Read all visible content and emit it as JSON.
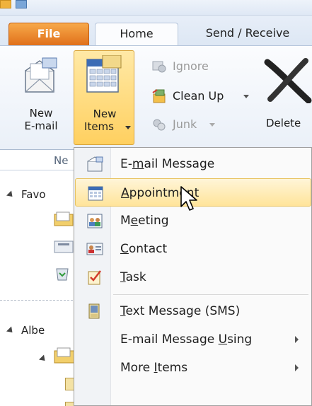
{
  "ribbon": {
    "tabs": [
      {
        "id": "file",
        "label": "File"
      },
      {
        "id": "home",
        "label": "Home"
      },
      {
        "id": "send",
        "label": "Send / Receive"
      }
    ],
    "new_email_line1": "New",
    "new_email_line2": "E-mail",
    "new_items_line1": "New",
    "new_items_line2": "Items",
    "ignore": "Ignore",
    "cleanup": "Clean Up",
    "junk": "Junk",
    "delete": "Delete",
    "group_label_partial": "Ne"
  },
  "nav": {
    "favorites_partial": "Favo",
    "account_partial": "Albe"
  },
  "menu": {
    "items": [
      {
        "pre": "E-",
        "u": "m",
        "post": "ail Message",
        "icon": "email-message-icon"
      },
      {
        "pre": "",
        "u": "A",
        "post": "ppointment",
        "icon": "calendar-icon",
        "highlighted": true
      },
      {
        "pre": "M",
        "u": "e",
        "post": "eting",
        "icon": "meeting-icon"
      },
      {
        "pre": "",
        "u": "C",
        "post": "ontact",
        "icon": "contact-card-icon"
      },
      {
        "pre": "",
        "u": "T",
        "post": "ask",
        "icon": "task-icon"
      },
      {
        "pre": "",
        "u": "T",
        "post": "ext Message (SMS)",
        "icon": "text-message-icon"
      },
      {
        "pre": "E-mail Message ",
        "u": "U",
        "post": "sing",
        "icon": "",
        "submenu": true
      },
      {
        "pre": "More ",
        "u": "I",
        "post": "tems",
        "icon": "",
        "submenu": true
      }
    ]
  },
  "colors": {
    "file_tab": "#e0701a",
    "highlight": "#ffe49a",
    "new_items_button": "#ffd060"
  }
}
